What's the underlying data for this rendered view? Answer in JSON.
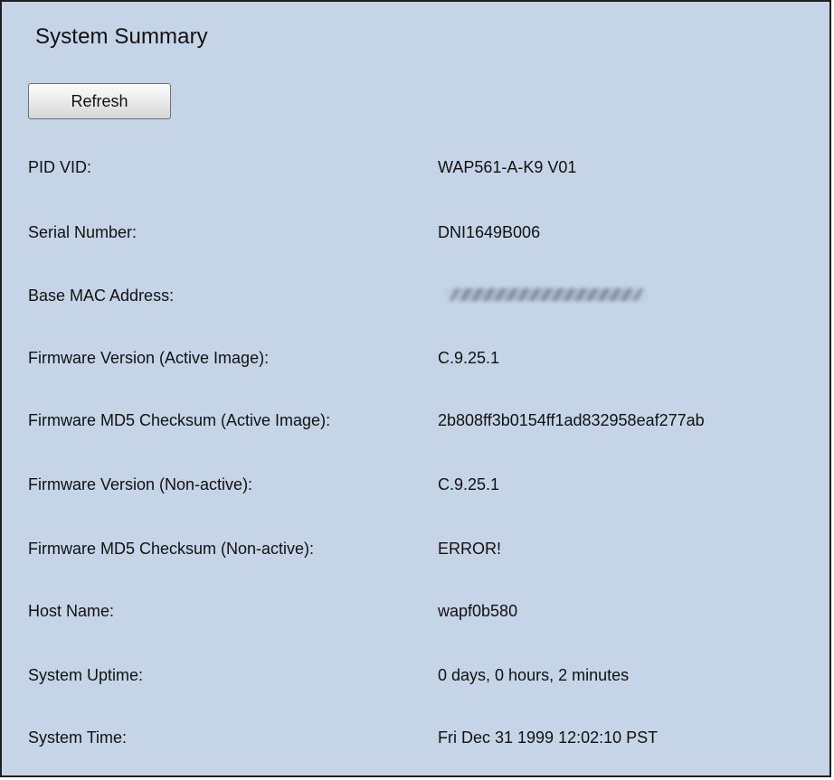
{
  "page": {
    "title": "System Summary",
    "refresh_label": "Refresh"
  },
  "rows": [
    {
      "label": "PID VID:",
      "value": "WAP561-A-K9 V01"
    },
    {
      "label": "Serial Number:",
      "value": "DNI1649B006"
    },
    {
      "label": "Base MAC Address:",
      "value": "",
      "obscured": true
    },
    {
      "label": "Firmware Version (Active Image):",
      "value": "C.9.25.1"
    },
    {
      "label": "Firmware MD5 Checksum (Active Image):",
      "value": "2b808ff3b0154ff1ad832958eaf277ab"
    },
    {
      "label": "Firmware Version (Non-active):",
      "value": "C.9.25.1"
    },
    {
      "label": "Firmware MD5 Checksum (Non-active):",
      "value": "ERROR!"
    },
    {
      "label": "Host Name:",
      "value": "wapf0b580"
    },
    {
      "label": "System Uptime:",
      "value": "0 days, 0 hours, 2 minutes"
    },
    {
      "label": "System Time:",
      "value": "Fri Dec 31 1999 12:02:10 PST"
    }
  ]
}
